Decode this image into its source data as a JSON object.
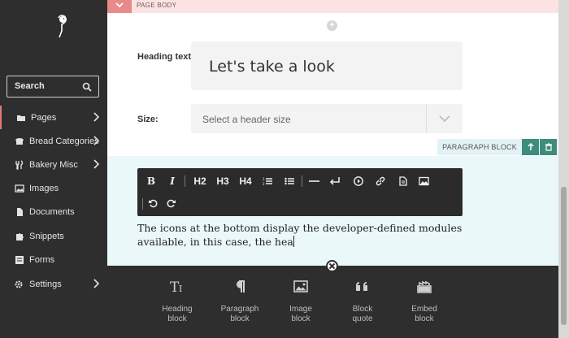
{
  "sidebar": {
    "search_placeholder": "Search",
    "items": [
      {
        "label": "Pages",
        "icon": "folder-open-icon",
        "has_chevron": true,
        "active": true
      },
      {
        "label": "Bread Categories",
        "icon": "bread-icon",
        "has_chevron": true
      },
      {
        "label": "Bakery Misc",
        "icon": "utensils-icon",
        "has_chevron": true
      },
      {
        "label": "Images",
        "icon": "image-icon",
        "has_chevron": false
      },
      {
        "label": "Documents",
        "icon": "document-icon",
        "has_chevron": false
      },
      {
        "label": "Snippets",
        "icon": "puzzle-icon",
        "has_chevron": false
      },
      {
        "label": "Forms",
        "icon": "form-icon",
        "has_chevron": false
      },
      {
        "label": "Settings",
        "icon": "cogs-icon",
        "has_chevron": true
      }
    ]
  },
  "page_body": {
    "label": "PAGE BODY"
  },
  "heading_block": {
    "heading_label": "Heading text:",
    "required_mark": "*",
    "heading_value": "Let's take a look",
    "size_label": "Size:",
    "size_placeholder": "Select a header size"
  },
  "paragraph_block": {
    "tag": "PARAGRAPH BLOCK",
    "toolbar": {
      "bold": "B",
      "italic": "I",
      "h2": "H2",
      "h3": "H3",
      "h4": "H4"
    },
    "text_line1": "The icons at the bottom display the developer-defined modules",
    "text_line2": "available, in this case, the hea"
  },
  "block_palette": [
    {
      "line1": "Heading",
      "line2": "block",
      "icon": "heading-icon"
    },
    {
      "line1": "Paragraph",
      "line2": "block",
      "icon": "pilcrow-icon"
    },
    {
      "line1": "Image",
      "line2": "block",
      "icon": "image-icon"
    },
    {
      "line1": "Block",
      "line2": "quote",
      "icon": "quote-icon"
    },
    {
      "line1": "Embed",
      "line2": "block",
      "icon": "embed-icon"
    }
  ],
  "colors": {
    "sidebar_bg": "#2e2e2e",
    "accent_red": "#e88a8a",
    "teal": "#3d8c7c",
    "paragraph_bg": "#eaf8fa"
  }
}
